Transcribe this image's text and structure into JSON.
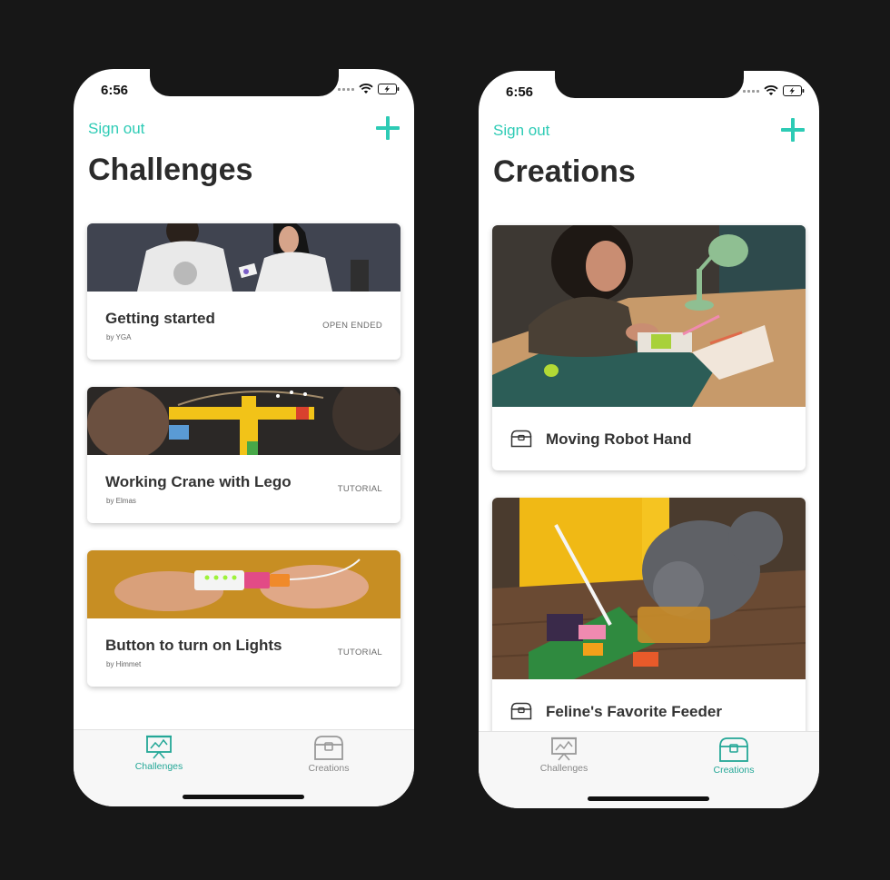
{
  "colors": {
    "accent": "#2dcbb5",
    "tab_active": "#24a797",
    "tab_inactive": "#888888",
    "background": "#171717"
  },
  "screens": [
    {
      "status_time": "6:56",
      "signout_label": "Sign out",
      "add_icon": "plus-icon",
      "title": "Challenges",
      "challenges": [
        {
          "title": "Getting started",
          "author": "by YGA",
          "type": "OPEN ENDED"
        },
        {
          "title": "Working Crane with Lego",
          "author": "by Elmas",
          "type": "TUTORIAL"
        },
        {
          "title": "Button to turn on Lights",
          "author": "by Himmet",
          "type": "TUTORIAL"
        }
      ],
      "tabs": [
        {
          "label": "Challenges",
          "icon": "easel-icon",
          "active": true
        },
        {
          "label": "Creations",
          "icon": "chest-icon",
          "active": false
        }
      ]
    },
    {
      "status_time": "6:56",
      "signout_label": "Sign out",
      "add_icon": "plus-icon",
      "title": "Creations",
      "creations": [
        {
          "title": "Moving Robot Hand",
          "icon": "chest-icon"
        },
        {
          "title": "Feline's Favorite Feeder",
          "icon": "chest-icon"
        }
      ],
      "tabs": [
        {
          "label": "Challenges",
          "icon": "easel-icon",
          "active": false
        },
        {
          "label": "Creations",
          "icon": "chest-icon",
          "active": true
        }
      ]
    }
  ]
}
